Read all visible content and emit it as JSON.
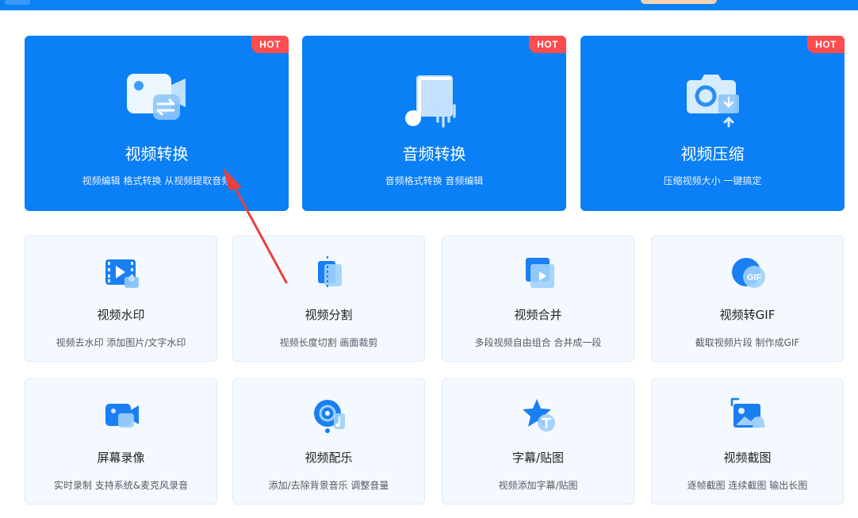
{
  "badge": {
    "hot": "HOT"
  },
  "main_cards": [
    {
      "title": "视频转换",
      "subtitle": "视频编辑 格式转换 从视频提取音频",
      "icon": "video-convert-icon"
    },
    {
      "title": "音频转换",
      "subtitle": "音频格式转换 音频编辑",
      "icon": "music-note-icon"
    },
    {
      "title": "视频压缩",
      "subtitle": "压缩视频大小 一键搞定",
      "icon": "camera-compress-icon"
    }
  ],
  "tool_cards": [
    {
      "title": "视频水印",
      "subtitle": "视频去水印 添加图片/文字水印",
      "icon": "film-watermark-icon"
    },
    {
      "title": "视频分割",
      "subtitle": "视频长度切割 画面裁剪",
      "icon": "split-icon"
    },
    {
      "title": "视频合并",
      "subtitle": "多段视频自由组合 合并成一段",
      "icon": "merge-icon"
    },
    {
      "title": "视频转GIF",
      "subtitle": "截取视频片段 制作成GIF",
      "icon": "gif-icon"
    },
    {
      "title": "屏幕录像",
      "subtitle": "实时录制 支持系统&麦克风录音",
      "icon": "screen-record-icon"
    },
    {
      "title": "视频配乐",
      "subtitle": "添加/去除背景音乐 调整音量",
      "icon": "disc-music-icon"
    },
    {
      "title": "字幕/贴图",
      "subtitle": "视频添加字幕/贴图",
      "icon": "star-text-icon"
    },
    {
      "title": "视频截图",
      "subtitle": "逐帧截图 连续截图 输出长图",
      "icon": "screenshot-image-icon"
    }
  ],
  "gif_icon_text": "GIF",
  "colors": {
    "header": "#0a82f5",
    "card_blue": "#0b7ff5",
    "hot_badge": "#ff4d4f",
    "tool_bg": "#f4f9ff",
    "arrow": "#e84040"
  }
}
